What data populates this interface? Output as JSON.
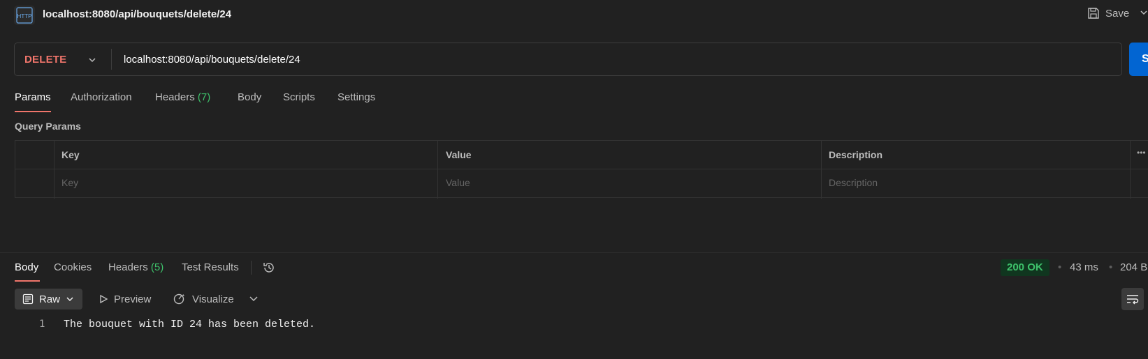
{
  "header": {
    "badge": "HTTP",
    "request_title": "localhost:8080/api/bouquets/delete/24",
    "save_label": "Save"
  },
  "request": {
    "method": "DELETE",
    "url": "localhost:8080/api/bouquets/delete/24",
    "send_label": "S"
  },
  "tabs": [
    {
      "label": "Params"
    },
    {
      "label": "Authorization"
    },
    {
      "label": "Headers",
      "count": "(7)"
    },
    {
      "label": "Body"
    },
    {
      "label": "Scripts"
    },
    {
      "label": "Settings"
    }
  ],
  "query_params": {
    "title": "Query Params",
    "columns": [
      "Key",
      "Value",
      "Description"
    ],
    "placeholders": [
      "Key",
      "Value",
      "Description"
    ]
  },
  "response": {
    "tabs": [
      {
        "label": "Body"
      },
      {
        "label": "Cookies"
      },
      {
        "label": "Headers",
        "count": "(5)"
      },
      {
        "label": "Test Results"
      }
    ],
    "status": "200 OK",
    "time": "43 ms",
    "size": "204 B",
    "format": "Raw",
    "preview_label": "Preview",
    "visualize_label": "Visualize",
    "lines": [
      {
        "number": "1",
        "text": "The bouquet with ID 24 has been deleted."
      }
    ]
  },
  "colors": {
    "accent": "#f0756b",
    "success": "#3ec26b",
    "send": "#0265d2",
    "background": "#212121"
  }
}
